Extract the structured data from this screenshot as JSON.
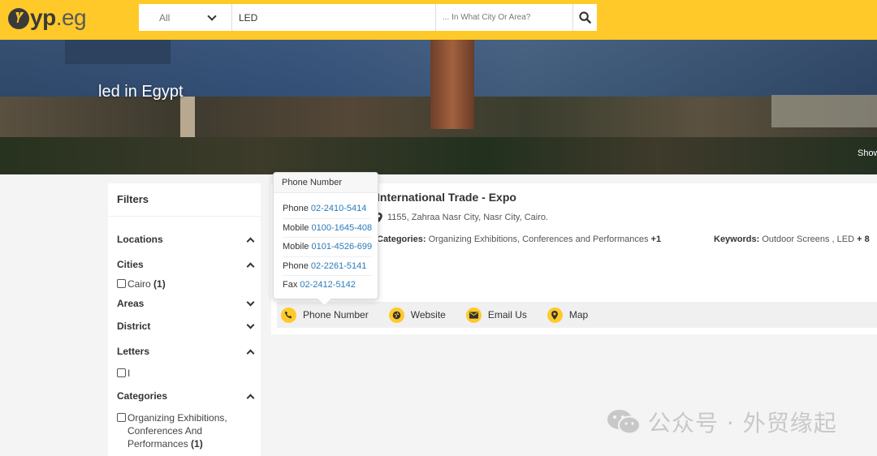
{
  "header": {
    "logo_brand": "yp",
    "logo_tld": ".eg",
    "search": {
      "category_selected": "All",
      "query_value": "LED",
      "location_placeholder": "... In What City Or Area?"
    }
  },
  "hero": {
    "title": "led in Egypt",
    "side_text": "Show"
  },
  "filters": {
    "title": "Filters",
    "sections": {
      "locations": "Locations",
      "cities": "Cities",
      "areas": "Areas",
      "district": "District",
      "letters": "Letters",
      "categories": "Categories"
    },
    "cities_option": {
      "label": "Cairo",
      "count": "(1)"
    },
    "letters_option": {
      "label": "I"
    },
    "categories_option": {
      "line1": "Organizing Exhibitions,",
      "line2": "Conferences And",
      "line3": "Performances",
      "count": "(1)"
    }
  },
  "listing": {
    "title": "International Trade - Expo",
    "address": "1155, Zahraa Nasr City, Nasr City, Cairo.",
    "categories_label": "Categories:",
    "categories_value": "Organizing Exhibitions, Conferences and Performances",
    "categories_more": "+1",
    "keywords_label": "Keywords:",
    "keywords_value": "Outdoor Screens , LED",
    "keywords_more": "+ 8",
    "actions": {
      "phone": "Phone Number",
      "website": "Website",
      "email": "Email Us",
      "map": "Map"
    }
  },
  "popover": {
    "title": "Phone Number",
    "items": [
      {
        "type": "Phone",
        "number": "02-2410-5414"
      },
      {
        "type": "Mobile",
        "number": "0100-1645-408"
      },
      {
        "type": "Mobile",
        "number": "0101-4526-699"
      },
      {
        "type": "Phone",
        "number": "02-2261-5141"
      },
      {
        "type": "Fax",
        "number": "02-2412-5142"
      }
    ]
  },
  "watermark": {
    "text": "公众号 · 外贸缘起"
  },
  "colors": {
    "brand_yellow": "#ffc92a",
    "link_blue": "#2a7ab8"
  }
}
